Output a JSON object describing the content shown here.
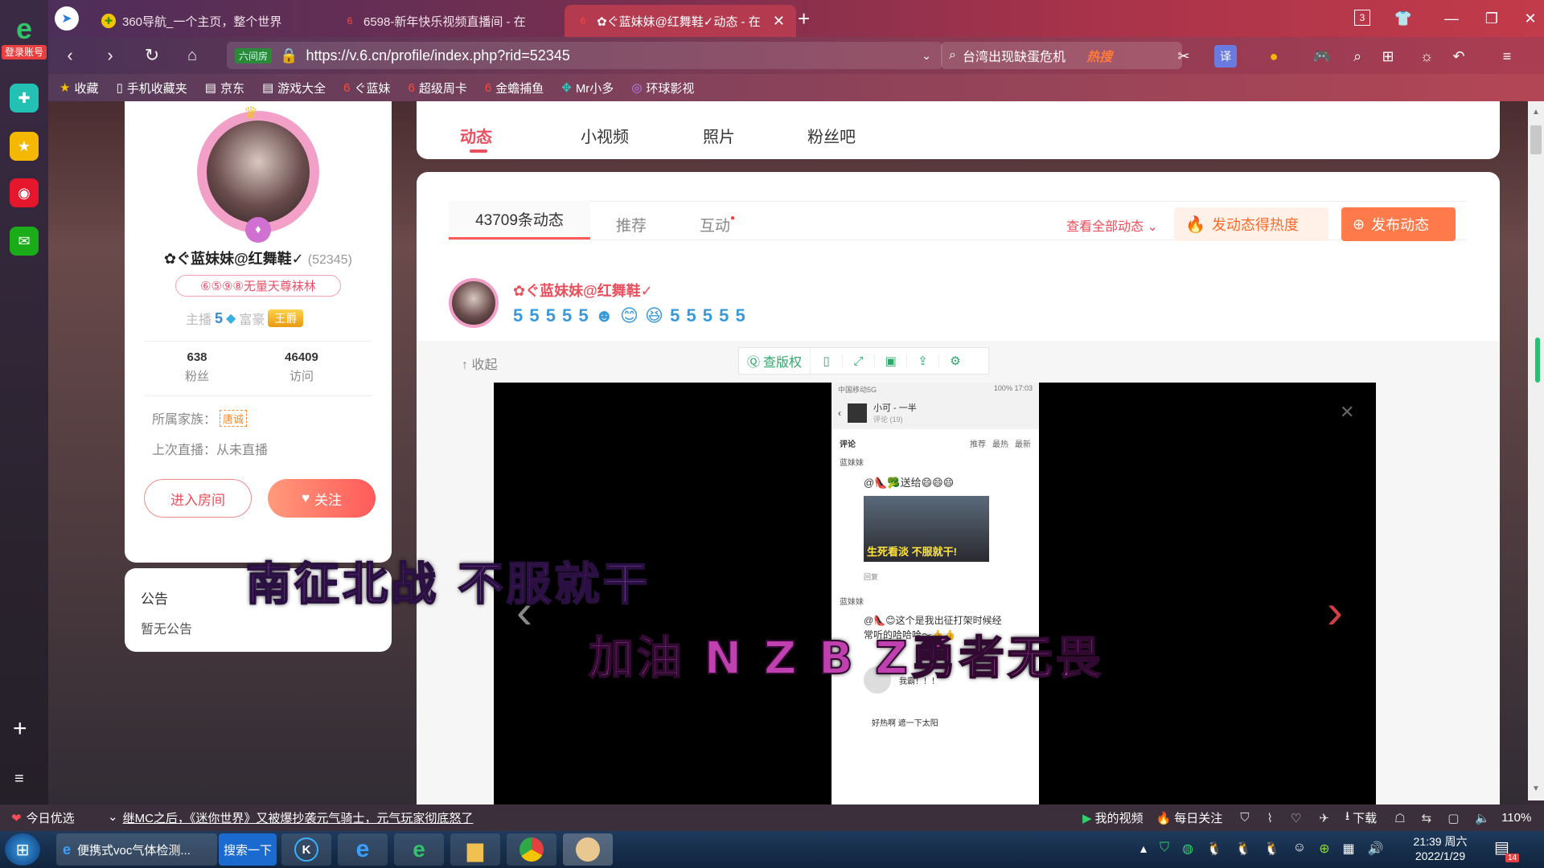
{
  "browser": {
    "tabs": [
      {
        "label": "360导航_一个主页，整个世界"
      },
      {
        "label": "6598-新年快乐视频直播间 - 在"
      },
      {
        "label": "✿ぐ蓝妹妹@红舞鞋✓动态 - 在"
      }
    ],
    "tab_count": "3",
    "account_label": "登录账号",
    "url": "https://v.6.cn/profile/index.php?rid=52345",
    "url_badge": "六间房",
    "search_text": "台湾出现缺蛋危机",
    "search_hot": "热搜",
    "bookmarks": [
      "收藏",
      "手机收藏夹",
      "京东",
      "游戏大全",
      "ぐ蓝妹",
      "超级周卡",
      "金蟾捕鱼",
      "Mr小多",
      "环球影视"
    ]
  },
  "profile": {
    "name": "✿ぐ蓝妹妹@红舞鞋✓",
    "rid": "(52345)",
    "family_tag": "⑥⑤⑨⑧无量天尊袜林",
    "anchor_label": "主播",
    "anchor_level": "5",
    "rich_label": "富豪",
    "rich_badge": "王爵",
    "fans_count": "638",
    "fans_label": "粉丝",
    "visits_count": "46409",
    "visits_label": "访问",
    "family_label": "所属家族：",
    "family_name": "唐诚",
    "last_live": "上次直播：从未直播",
    "enter_room": "进入房间",
    "follow": "关注"
  },
  "notice": {
    "title": "公告",
    "content": "暂无公告"
  },
  "main_tabs": [
    "动态",
    "小视频",
    "照片",
    "粉丝吧"
  ],
  "feed": {
    "sub_tabs": [
      "43709条动态",
      "推荐",
      "互动"
    ],
    "view_all": "查看全部动态",
    "hot_button": "发动态得热度",
    "post_button": "发布动态",
    "post_author": "✿ぐ蓝妹妹@红舞鞋✓",
    "post_emojis": "5 5 5 5 5 ☻ 😊 😆 5 5 5 5 5",
    "collapse": "收起",
    "viewer_tools": [
      "查版权"
    ]
  },
  "phone": {
    "carrier": "中国移动5G",
    "battery": "100%",
    "time": "17:03",
    "chat_title": "小可 - 一半",
    "chat_sub": "评论 (19)",
    "comments_title": "评论",
    "sort_tabs": [
      "推荐",
      "最热",
      "最新"
    ],
    "c1_name": "蓝妹妹",
    "c1_text": "@👠🥦送给😄😄😄",
    "c1_caption": "生死看淡 不服就干!",
    "reply": "回复",
    "c2_name": "蓝妹妹",
    "c2_text": "@👠😊这个是我出征打架时候经常听的哈哈哈～👍👍",
    "sticker1": "我霸！！！",
    "sticker2": "好热啊 遮一下太阳"
  },
  "overlay": {
    "line1": "南征北战  不服就干",
    "line2": "加油 N Z B Z勇者无畏"
  },
  "statusbar": {
    "left": "今日优选",
    "news": "继MC之后，《迷你世界》又被爆抄袭元气骑士，元气玩家彻底怒了",
    "my_video": "我的视频",
    "daily": "每日关注",
    "download": "下载",
    "zoom": "110%"
  },
  "taskbar": {
    "app1": "便携式voc气体检测...",
    "search_btn": "搜索一下",
    "clock_time": "21:39 周六",
    "clock_date": "2022/1/29",
    "notif": "14"
  }
}
